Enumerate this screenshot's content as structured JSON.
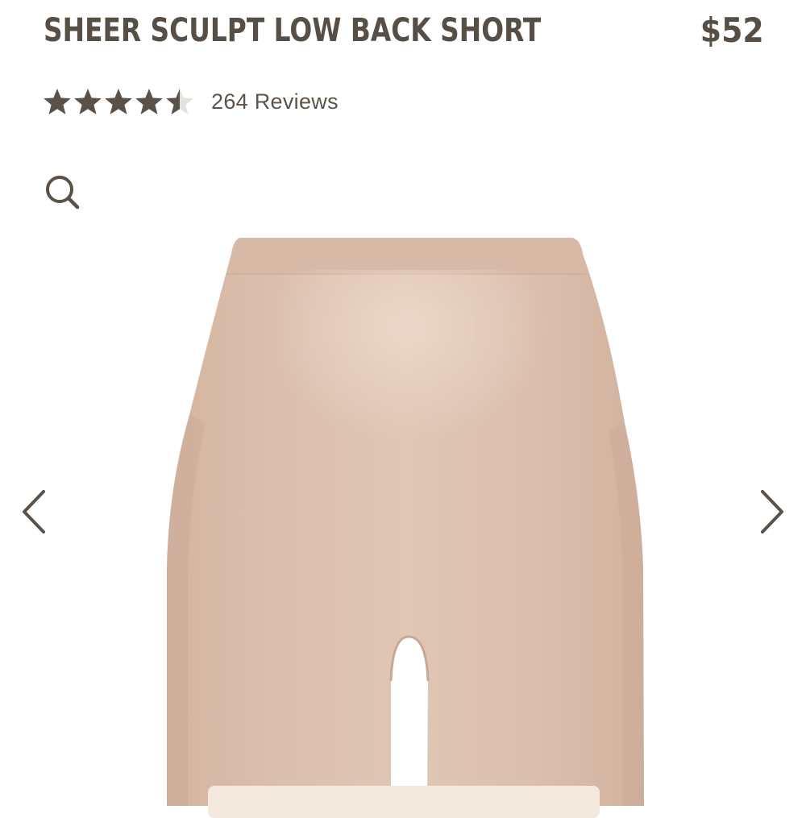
{
  "product": {
    "title": "SHEER SCULPT LOW BACK SHORT",
    "price": "$52"
  },
  "rating": {
    "stars": 4.5,
    "max_stars": 5,
    "reviews_label": "264 Reviews"
  },
  "icons": {
    "zoom": "search-icon",
    "prev": "chevron-left-icon",
    "next": "chevron-right-icon",
    "star": "star-icon"
  },
  "colors": {
    "text": "#574f45",
    "star_filled": "#5a5148",
    "star_empty": "#e6e3df",
    "product_skin": "#dbbfac"
  }
}
